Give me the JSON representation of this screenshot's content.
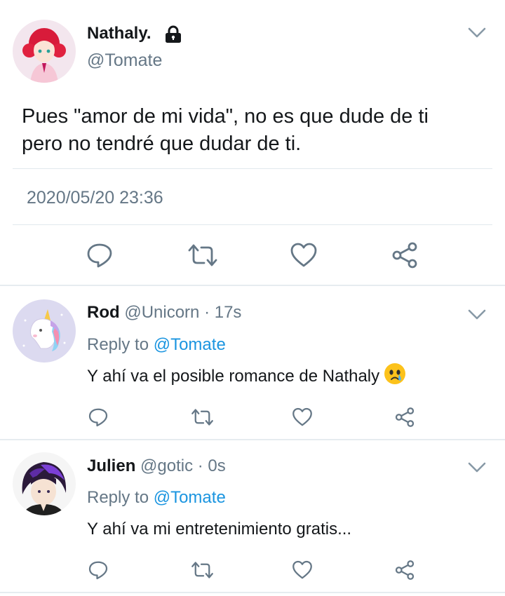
{
  "main_tweet": {
    "display_name": "Nathaly.",
    "handle": "@Tomate",
    "text_line1": "Pues \"amor de mi vida\", no es que dude de ti",
    "text_line2": "pero no tendré que dudar de ti.",
    "timestamp": "2020/05/20 23:36"
  },
  "replies": [
    {
      "display_name": "Rod",
      "handle": "@Unicorn",
      "time": "· 17s",
      "reply_prefix": "Reply to",
      "reply_to": "@Tomate",
      "text": "Y ahí va el posible romance de Nathaly",
      "emoji": "😢"
    },
    {
      "display_name": "Julien",
      "handle": "@gotic",
      "time": "· 0s",
      "reply_prefix": "Reply to",
      "reply_to": "@Tomate",
      "text": "Y ahí va mi entretenimiento gratis..."
    }
  ],
  "colors": {
    "accent": "#1b95e0",
    "icon_grey": "#657786",
    "divider": "#e1e8ed"
  },
  "icons": [
    "lock-icon",
    "chevron-down-icon",
    "reply-icon",
    "retweet-icon",
    "like-icon",
    "share-icon"
  ]
}
